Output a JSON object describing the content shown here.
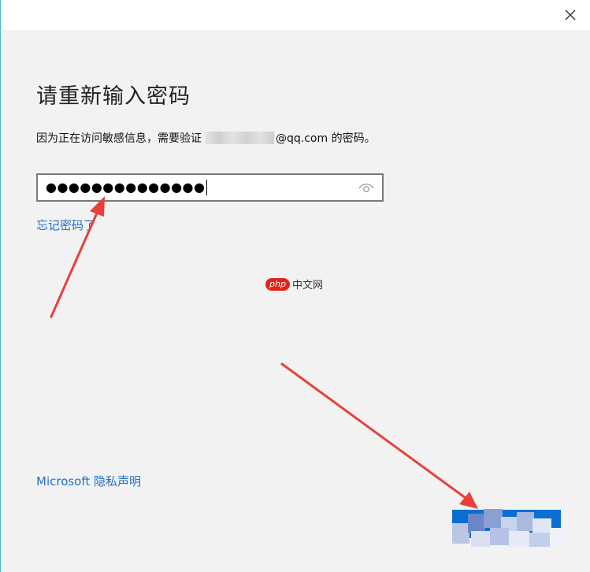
{
  "dialog": {
    "heading": "请重新输入密码",
    "description_before": "因为正在访问敏感信息，需要验证",
    "description_after": "@qq.com 的密码。",
    "password_masked": "●●●●●●●●●●●●●●",
    "forgot_link": "忘记密码了",
    "privacy_link": "Microsoft 隐私声明",
    "confirm_button": ""
  },
  "watermark": {
    "badge": "php",
    "text": "中文网"
  },
  "icons": {
    "close": "close-icon",
    "reveal": "eye-icon"
  },
  "colors": {
    "accent": "#0a6fd1",
    "link": "#1e6fd0",
    "arrow": "#e8403a",
    "background": "#f2f2f2"
  }
}
